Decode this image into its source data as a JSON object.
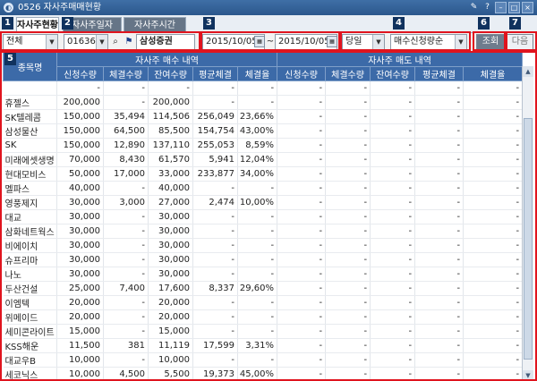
{
  "window": {
    "title": "0526 자사주매매현황",
    "logo_glyph": "◐"
  },
  "tabs": [
    {
      "label": "자사주현황",
      "active": true
    },
    {
      "label": "자사주일자",
      "active": false
    },
    {
      "label": "자사주시간",
      "active": false
    }
  ],
  "toolbar": {
    "market_select": "전체",
    "code_input": "016360",
    "broker_name": "삼성증권",
    "date_from": "2015/10/05",
    "date_sep": "~",
    "date_to": "2015/10/05",
    "period_select": "당일",
    "sort_select": "매수신청량순",
    "query_button": "조회",
    "next_button": "다음"
  },
  "markers": [
    "1",
    "2",
    "3",
    "4",
    "5",
    "6",
    "7"
  ],
  "table": {
    "name_header": "종목명",
    "buy_group": "자사주 매수 내역",
    "sell_group": "자사주 매도 내역",
    "sub_headers": [
      "신청수량",
      "체결수량",
      "잔여수량",
      "평균체결",
      "체결율",
      "신청수량",
      "체결수량",
      "잔여수량",
      "평균체결",
      "체결율"
    ],
    "rows": [
      [
        "",
        "-",
        "-",
        "-",
        "-",
        "-",
        "-",
        "-",
        "-",
        "-",
        "-"
      ],
      [
        "휴젤스",
        "200,000",
        "-",
        "200,000",
        "-",
        "-",
        "-",
        "-",
        "-",
        "-",
        "-"
      ],
      [
        "SK텔레콤",
        "150,000",
        "35,494",
        "114,506",
        "256,049",
        "23,66%",
        "-",
        "-",
        "-",
        "-",
        "-"
      ],
      [
        "삼성물산",
        "150,000",
        "64,500",
        "85,500",
        "154,754",
        "43,00%",
        "-",
        "-",
        "-",
        "-",
        "-"
      ],
      [
        "SK",
        "150,000",
        "12,890",
        "137,110",
        "255,053",
        "8,59%",
        "-",
        "-",
        "-",
        "-",
        "-"
      ],
      [
        "미래에셋생명",
        "70,000",
        "8,430",
        "61,570",
        "5,941",
        "12,04%",
        "-",
        "-",
        "-",
        "-",
        "-"
      ],
      [
        "현대모비스",
        "50,000",
        "17,000",
        "33,000",
        "233,877",
        "34,00%",
        "-",
        "-",
        "-",
        "-",
        "-"
      ],
      [
        "멜파스",
        "40,000",
        "-",
        "40,000",
        "-",
        "-",
        "-",
        "-",
        "-",
        "-",
        "-"
      ],
      [
        "영풍제지",
        "30,000",
        "3,000",
        "27,000",
        "2,474",
        "10,00%",
        "-",
        "-",
        "-",
        "-",
        "-"
      ],
      [
        "대교",
        "30,000",
        "-",
        "30,000",
        "-",
        "-",
        "-",
        "-",
        "-",
        "-",
        "-"
      ],
      [
        "삼화네트웍스",
        "30,000",
        "-",
        "30,000",
        "-",
        "-",
        "-",
        "-",
        "-",
        "-",
        "-"
      ],
      [
        "비에이치",
        "30,000",
        "-",
        "30,000",
        "-",
        "-",
        "-",
        "-",
        "-",
        "-",
        "-"
      ],
      [
        "슈프리마",
        "30,000",
        "-",
        "30,000",
        "-",
        "-",
        "-",
        "-",
        "-",
        "-",
        "-"
      ],
      [
        "나노",
        "30,000",
        "-",
        "30,000",
        "-",
        "-",
        "-",
        "-",
        "-",
        "-",
        "-"
      ],
      [
        "두산건설",
        "25,000",
        "7,400",
        "17,600",
        "8,337",
        "29,60%",
        "-",
        "-",
        "-",
        "-",
        "-"
      ],
      [
        "이엠텍",
        "20,000",
        "-",
        "20,000",
        "-",
        "-",
        "-",
        "-",
        "-",
        "-",
        "-"
      ],
      [
        "위메이드",
        "20,000",
        "-",
        "20,000",
        "-",
        "-",
        "-",
        "-",
        "-",
        "-",
        "-"
      ],
      [
        "세미콘라이트",
        "15,000",
        "-",
        "15,000",
        "-",
        "-",
        "-",
        "-",
        "-",
        "-",
        "-"
      ],
      [
        "KSS해운",
        "11,500",
        "381",
        "11,119",
        "17,599",
        "3,31%",
        "-",
        "-",
        "-",
        "-",
        "-"
      ],
      [
        "대교우B",
        "10,000",
        "-",
        "10,000",
        "-",
        "-",
        "-",
        "-",
        "-",
        "-",
        "-"
      ],
      [
        "세코닉스",
        "10,000",
        "4,500",
        "5,500",
        "19,373",
        "45,00%",
        "-",
        "-",
        "-",
        "-",
        "-"
      ]
    ]
  },
  "colors": {
    "header_bg": "#3c6aa8",
    "annotation_red": "#e0141e",
    "marker_bg": "#10325e"
  }
}
